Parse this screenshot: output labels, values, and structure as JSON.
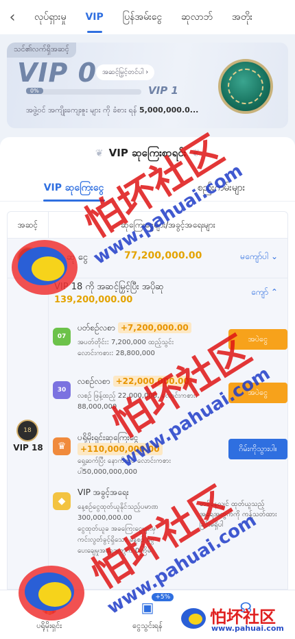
{
  "topnav": {
    "back_icon": "chevron-left-icon",
    "tabs": [
      "လုပ်ရှားမှု",
      "VIP",
      "ပြန်အမ်းငွေ",
      "ဆုလာဘ်",
      "အတိုး"
    ],
    "active_tab": "VIP"
  },
  "vip_card": {
    "tag": "သင်၏လက်ရှိအဆင့်",
    "current_level": "VIP 0",
    "upgrade_button": "အဆင့်မြှင့်တင်ပါ ›",
    "progress_label": "0%",
    "progress_fraction": 0,
    "next_level": "VIP 1",
    "hint_prefix": "အဖွဲ့ဝင် အကျိုးကျေးဇူး များ ကို ခံစား ရန်",
    "hint_amount": "5,000,000.0..."
  },
  "panel": {
    "title": "VIP ဆုကြေးစာရင်း",
    "tabs": [
      "VIP ဆုကြေးငွေ",
      "စည်းကမ်းများ"
    ],
    "table_header": [
      "အဆင့်",
      "ဆုကြေးငွေများ/အခွင့်အရေးများ"
    ],
    "row1": {
      "label": "ဆု ငွေ",
      "amount": "77,200,000.00",
      "action": "မကျော်ပါ ⌄"
    },
    "row2": {
      "level_badge": "18",
      "level_label": "VIP 18",
      "heading": "VIP 18 ကို အဆင့်မြှင့်ပြီး အပိုဆု",
      "heading_amount": "139,200,000.00",
      "action": "ကျော် ⌃",
      "items": [
        {
          "icon": "07",
          "name": "ပတ်စဉ်လစာ",
          "bonus": "+7,200,000.00",
          "desc_1": "အပတ်တိုင်း: 7,200,000 ထည့်သွင်း",
          "desc_2": "လောင်းကစား: 28,800,000",
          "button": "အပဲငွေ"
        },
        {
          "icon": "30",
          "name": "လစဉ်လစာ",
          "bonus": "+22,000,000.00",
          "desc_1": "လစဉ် ဖြန့်ထည့် 22,000,000, လောင်းကစား:",
          "desc_2": "88,000,000",
          "button": "အပဲငွေ"
        },
        {
          "icon": "trophy",
          "name": "ပရိုမိုးရှင်းဆုကြေးငွေ",
          "bonus": "+110,000,000.00",
          "desc_1": "ရှေ့ဆက်ပြီး နောက်ထပ် လောင်းကစား",
          "desc_2": "ပါ50,000,000,000",
          "button": "ဂိမ်းကိုသွားပါ။"
        },
        {
          "icon": "diamond",
          "name": "VIP အခွင့်အရေး",
          "desc_1": "နေ့စဉ်ငွေထုတ်ယူနိုင်သည့်ပမာဏ",
          "desc_2": "300,000,000.00",
          "desc_3": "ငွေထုတ်ယူခ အခကြေးငွေများမှ",
          "desc_4": "ကင်းလွတ်ခွင့်ရှိသော နေ့စဉ် ငွေ",
          "desc_5": "ပေးချေမှုအရေအတွက် 0ကြိမ်",
          "right_1": "တစ်နေ့လျှင် ထုတ်ယူသည့်",
          "right_2": "အရေအတွက်ကို ကန့်သတ်ထား",
          "right_3": "ခြင်းမရှိပါ"
        }
      ]
    }
  },
  "bottom_nav": {
    "items": [
      {
        "label": "ပရိုမိုးရှင်း",
        "icon": "gift-icon"
      },
      {
        "label": "ငွေသွင်းရန်",
        "icon": "wallet-icon",
        "badge": "+5%"
      },
      {
        "label": "",
        "icon": "headset-icon"
      }
    ]
  },
  "watermark": {
    "cn_text": "怕坏社区",
    "url_text": "www.pahuai.com",
    "logo_text": "怕坏社区",
    "logo_url": "www.pahuai.com"
  },
  "colors": {
    "accent": "#2f6fe0",
    "gold": "#e3a300",
    "orange_button": "#f7a21b",
    "watermark_red": "#de1414"
  }
}
